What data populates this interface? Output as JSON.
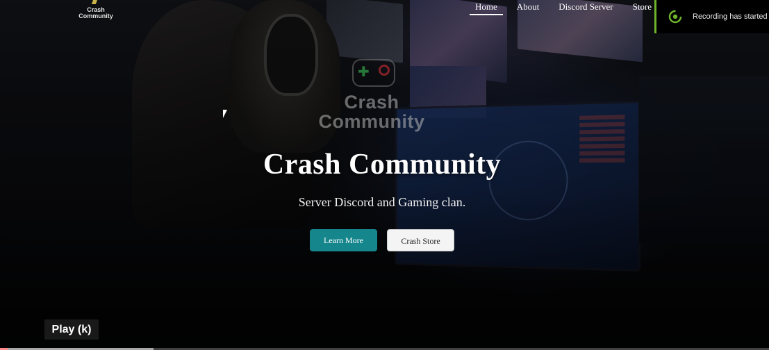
{
  "header": {
    "logo_text_line1": "Crash",
    "logo_text_line2": "Community",
    "nav": [
      {
        "label": "Home",
        "active": true
      },
      {
        "label": "About",
        "active": false
      },
      {
        "label": "Discord Server",
        "active": false
      },
      {
        "label": "Store",
        "active": false
      }
    ]
  },
  "recording_toast": {
    "text": "Recording has started",
    "icon": "recording-indicator-icon",
    "accent": "#6fb52c"
  },
  "hero": {
    "watermark_line1": "Crash",
    "watermark_line2": "Community",
    "title": "Crash Community",
    "subtitle": "Server Discord and Gaming clan.",
    "primary_button": "Learn More",
    "secondary_button": "Crash Store",
    "primary_color": "#16868d"
  },
  "player": {
    "tooltip": "Play (k)",
    "progress_fraction": 0.01,
    "buffered_fraction": 0.2,
    "progress_color": "#ff0000"
  }
}
